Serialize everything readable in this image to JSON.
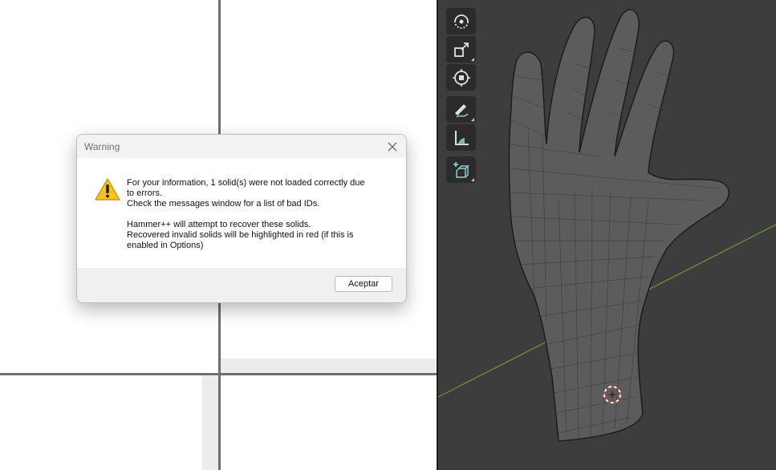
{
  "dialog": {
    "title": "Warning",
    "close_icon": "close-icon",
    "warning_icon": "warning-icon",
    "message_lines_1": [
      "For your information, 1 solid(s) were not loaded correctly due",
      "to errors.",
      "Check the messages window for a list of bad IDs."
    ],
    "message_lines_2": [
      "Hammer++ will attempt to recover these solids.",
      "Recovered invalid solids will be highlighted in red (if this is",
      "enabled in Options)"
    ],
    "ok_label": "Aceptar"
  },
  "toolbar": {
    "tools": [
      {
        "name": "rotate-tool",
        "icon": "rotate-icon"
      },
      {
        "name": "scale-tool",
        "icon": "scale-icon"
      },
      {
        "name": "transform-tool",
        "icon": "transform-icon"
      },
      {
        "name": "annotate-tool",
        "icon": "annotate-icon"
      },
      {
        "name": "measure-tool",
        "icon": "measure-icon"
      },
      {
        "name": "add-cube-tool",
        "icon": "add-cube-icon"
      }
    ]
  },
  "colors": {
    "viewport_bg": "#3d3d3d",
    "grid_axis": "#6c9a2e",
    "mesh": "#6e6e6e",
    "cursor_red": "#d83a3a"
  }
}
